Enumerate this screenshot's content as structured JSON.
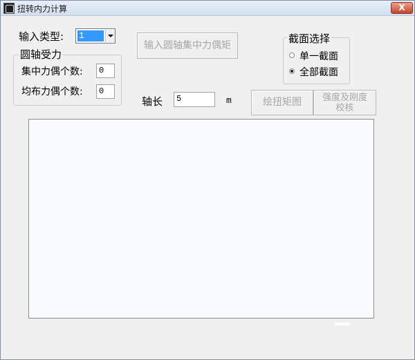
{
  "window": {
    "title": "扭转内力计算",
    "close_label": "X"
  },
  "input_type": {
    "label": "输入类型:",
    "selected": "1"
  },
  "load_group": {
    "title": "圆轴受力",
    "concentrated_label": "集中力偶个数:",
    "concentrated_value": "0",
    "distributed_label": "均布力偶个数:",
    "distributed_value": "0"
  },
  "input_button": {
    "label": "输入圆轴集中力偶矩"
  },
  "section_group": {
    "title": "截面选择",
    "option_single": "单一截面",
    "option_all": "全部截面",
    "selected": "全部截面"
  },
  "shaft_length": {
    "label": "轴长",
    "value": "5",
    "unit": "m"
  },
  "draw_button": {
    "label": "绘扭矩图"
  },
  "check_button": {
    "line1": "强度及刚度",
    "line2": "校核"
  }
}
